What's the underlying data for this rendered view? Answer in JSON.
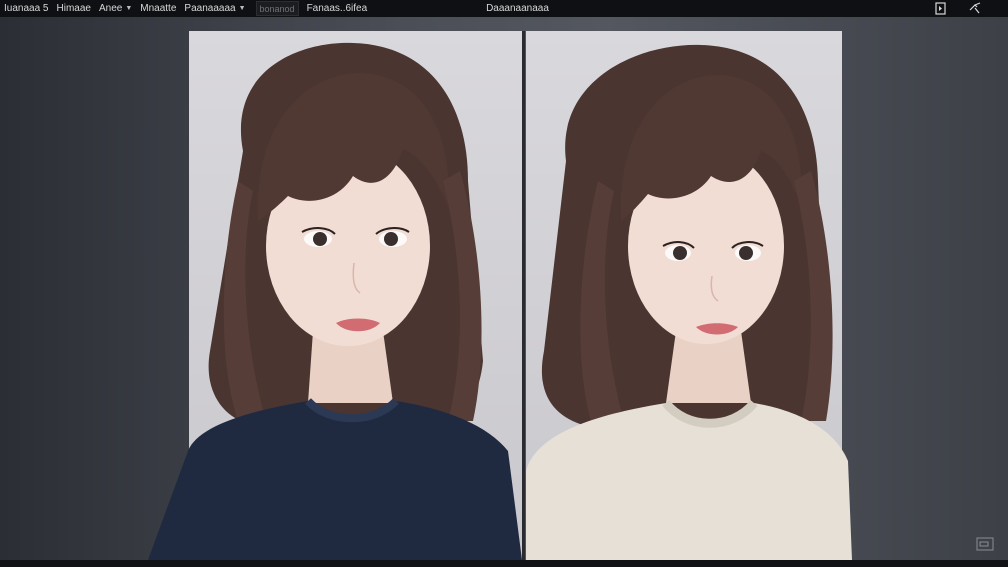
{
  "menubar": {
    "items": [
      {
        "label": "Iuanaaa 5"
      },
      {
        "label": "Himaae"
      },
      {
        "label": "Anee",
        "has_caret": true
      },
      {
        "label": "Mnaatte"
      },
      {
        "label": "Paanaaaaa",
        "has_caret": true
      }
    ],
    "field_text": "bonanod",
    "secondary_label": "Fanaas..6ifea"
  },
  "document": {
    "title": "Daaanaanaaa"
  },
  "toolbar_icons": [
    "panel-toggle-icon",
    "swap-arrows-icon"
  ],
  "comparison": {
    "left_subject": {
      "sweater_color": "#1f2a40"
    },
    "right_subject": {
      "sweater_color": "#e6e0d6"
    },
    "hair_color": "#4a3531",
    "skin_color": "#f2ddd4",
    "backdrop_color": "#d5d4d8"
  },
  "status_icon": "view-mode-icon"
}
